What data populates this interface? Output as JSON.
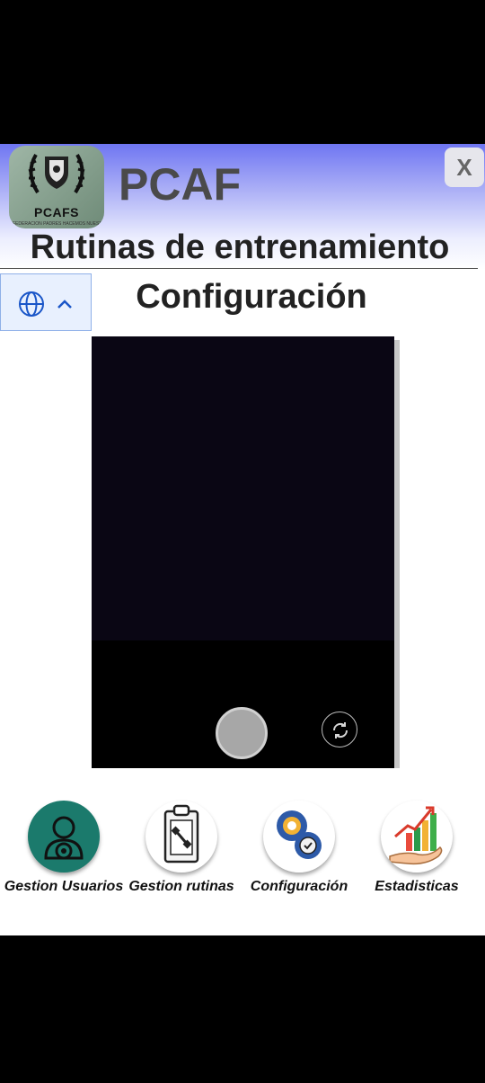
{
  "header": {
    "logo_text": "PCAFS",
    "logo_subtext": "FEDERACION PADRES HACEMOS NUESTRO",
    "app_title": "PCAF",
    "close_label": "X",
    "subtitle": "Rutinas de entrenamiento"
  },
  "section": {
    "title": "Configuración"
  },
  "bottom_nav": [
    {
      "label": "Gestion Usuarios",
      "icon": "user-gear-icon"
    },
    {
      "label": "Gestion rutinas",
      "icon": "clipboard-dumbbell-icon"
    },
    {
      "label": "Configuración",
      "icon": "gears-icon"
    },
    {
      "label": "Estadisticas",
      "icon": "chart-hand-icon"
    }
  ],
  "colors": {
    "header_accent": "#6f76f2",
    "user_icon_bg": "#1b7a6c",
    "title_text": "#4a4a4a"
  }
}
